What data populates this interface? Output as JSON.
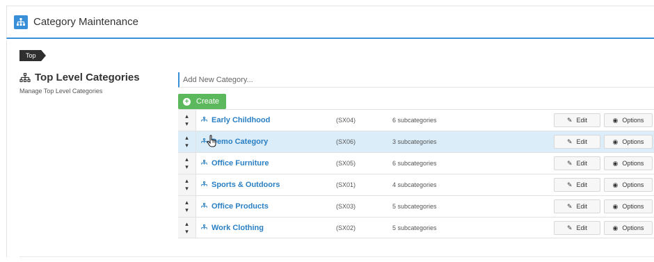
{
  "header": {
    "title": "Category Maintenance",
    "icon": "sitemap-icon",
    "accent": "#3a8fd9"
  },
  "breadcrumb": {
    "label": "Top"
  },
  "section": {
    "title": "Top Level Categories",
    "subtitle": "Manage Top Level Categories"
  },
  "add": {
    "placeholder": "Add New Category...",
    "create_label": "Create",
    "create_color": "#5cb85c"
  },
  "categories": [
    {
      "name": "Early Childhood",
      "code": "(SX04)",
      "subcategories": "6 subcategories",
      "edit": "Edit",
      "options": "Options"
    },
    {
      "name": "Demo Category",
      "code": "(SX06)",
      "subcategories": "3 subcategories",
      "edit": "Edit",
      "options": "Options"
    },
    {
      "name": "Office Furniture",
      "code": "(SX05)",
      "subcategories": "6 subcategories",
      "edit": "Edit",
      "options": "Options"
    },
    {
      "name": "Sports & Outdoors",
      "code": "(SX01)",
      "subcategories": "4 subcategories",
      "edit": "Edit",
      "options": "Options"
    },
    {
      "name": "Office Products",
      "code": "(SX03)",
      "subcategories": "5 subcategories",
      "edit": "Edit",
      "options": "Options"
    },
    {
      "name": "Work Clothing",
      "code": "(SX02)",
      "subcategories": "5 subcategories",
      "edit": "Edit",
      "options": "Options"
    }
  ]
}
